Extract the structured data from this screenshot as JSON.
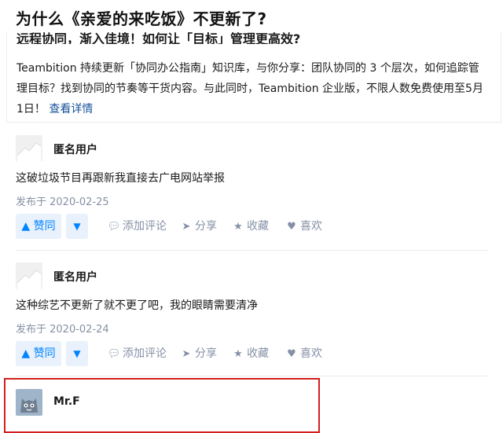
{
  "question": {
    "title": "为什么《亲爱的来吃饭》不更新了?"
  },
  "ad": {
    "title": "远程协同，渐入佳境！如何让「目标」管理更高效?",
    "text": "Teambition 持续更新「协同办公指南」知识库，与你分享：团队协同的 3 个层次，如何追踪管理目标？找到协同的节奏等干货内容。与此同时，Teambition 企业版，不限人数免费使用至5月1日！",
    "link": "查看详情"
  },
  "actions": {
    "vote_up": "▲ 赞同",
    "vote_down": "▼",
    "comment": "添加评论",
    "share": "分享",
    "collect": "收藏",
    "like": "喜欢"
  },
  "answers": [
    {
      "author": "匿名用户",
      "content": "这破垃圾节目再跟新我直接去广电网站举报",
      "date": "发布于 2020-02-25"
    },
    {
      "author": "匿名用户",
      "content": "这种综艺不更新了就不更了吧，我的眼睛需要清净",
      "date": "发布于 2020-02-24"
    },
    {
      "author": "Mr.F"
    }
  ],
  "colors": {
    "accent": "#0084ff",
    "muted": "#8590a6",
    "highlight": "#d11f1f"
  }
}
